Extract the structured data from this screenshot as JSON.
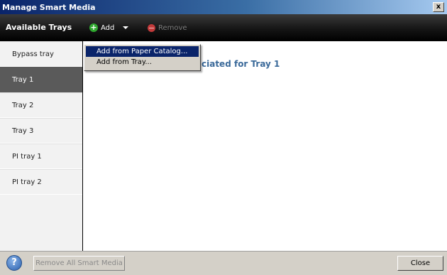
{
  "window": {
    "title": "Manage Smart Media",
    "close_glyph": "x"
  },
  "header": {
    "available_trays_label": "Available Trays",
    "add_label": "Add",
    "remove_label": "Remove"
  },
  "sidebar": {
    "items": [
      {
        "label": "Bypass tray"
      },
      {
        "label": "Tray 1"
      },
      {
        "label": "Tray 2"
      },
      {
        "label": "Tray 3"
      },
      {
        "label": "PI tray 1"
      },
      {
        "label": "PI tray 2"
      }
    ],
    "selected": "Tray 1"
  },
  "main": {
    "heading_visible": "ciated for Tray 1"
  },
  "add_menu": {
    "items": [
      {
        "label": "Add from Paper Catalog..."
      },
      {
        "label": "Add from Tray..."
      }
    ],
    "highlighted": "Add from Paper Catalog..."
  },
  "footer": {
    "help_glyph": "?",
    "remove_all_label": "Remove All Smart Media",
    "close_label": "Close"
  },
  "colors": {
    "title_bar": "#0a246a",
    "selected_tray": "#5a5a5a",
    "heading_text": "#3b6a9a",
    "add_icon": "#2fa82f",
    "remove_icon": "#c23a3a"
  },
  "icons": [
    "plus-icon",
    "chevron-down-icon",
    "minus-icon",
    "help-icon",
    "close-icon"
  ]
}
